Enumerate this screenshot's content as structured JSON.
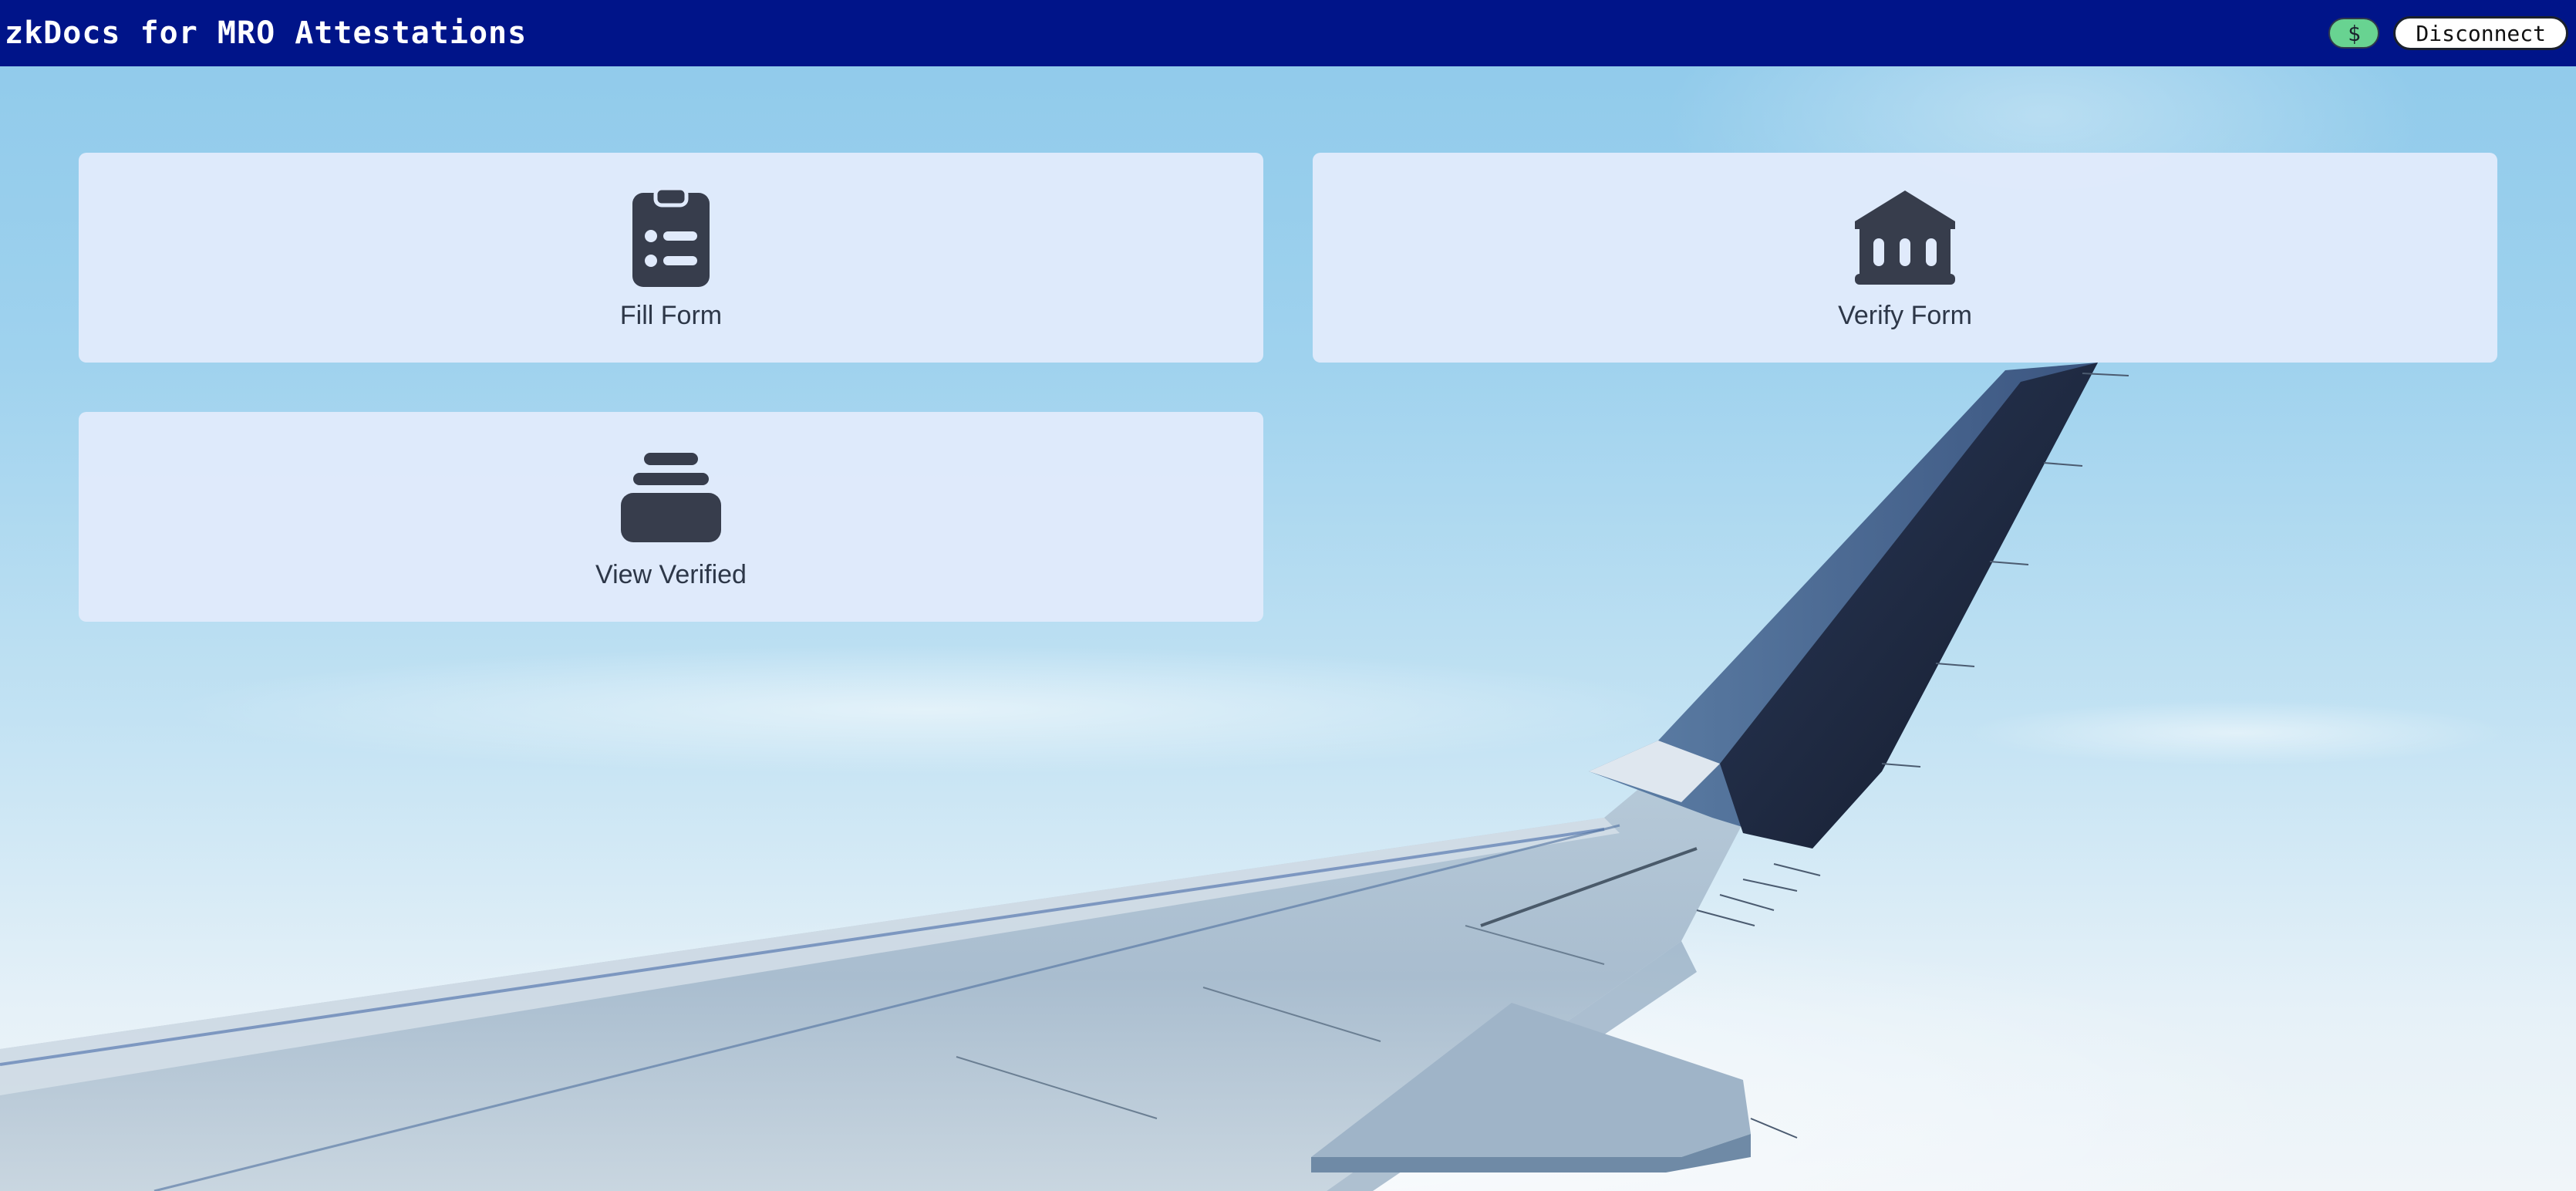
{
  "header": {
    "title": "zkDocs for MRO Attestations",
    "balance_label": "$",
    "disconnect_label": "Disconnect"
  },
  "cards": [
    {
      "label": "Fill Form",
      "icon": "clipboard-list-icon"
    },
    {
      "label": "Verify Form",
      "icon": "bank-building-icon"
    },
    {
      "label": "View Verified",
      "icon": "inbox-stack-icon"
    }
  ],
  "colors": {
    "header_bg": "#001489",
    "card_bg": "#e0eafb",
    "icon_color": "#373d4c",
    "balance_badge": "#68d391"
  },
  "background": "airplane-wing-sky-photo"
}
